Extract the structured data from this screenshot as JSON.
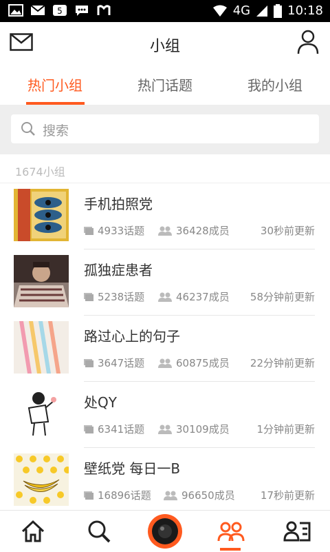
{
  "status": {
    "network": "4G",
    "time": "10:18"
  },
  "header": {
    "title": "小组"
  },
  "tabs": [
    {
      "label": "热门小组"
    },
    {
      "label": "热门话题"
    },
    {
      "label": "我的小组"
    }
  ],
  "search": {
    "placeholder": "搜索"
  },
  "list": {
    "count_label": "1674小组",
    "items": [
      {
        "name": "手机拍照党",
        "topics": "4933话题",
        "members": "36428成员",
        "updated": "30秒前更新"
      },
      {
        "name": "孤独症患者",
        "topics": "5238话题",
        "members": "46237成员",
        "updated": "58分钟前更新"
      },
      {
        "name": "路过心上的句子",
        "topics": "3647话题",
        "members": "60875成员",
        "updated": "22分钟前更新"
      },
      {
        "name": "处QY",
        "topics": "6341话题",
        "members": "30109成员",
        "updated": "1分钟前更新"
      },
      {
        "name": "壁纸党 每日一B",
        "topics": "16896话题",
        "members": "96650成员",
        "updated": "17秒前更新"
      }
    ]
  },
  "colors": {
    "accent": "#ff5a1f"
  }
}
